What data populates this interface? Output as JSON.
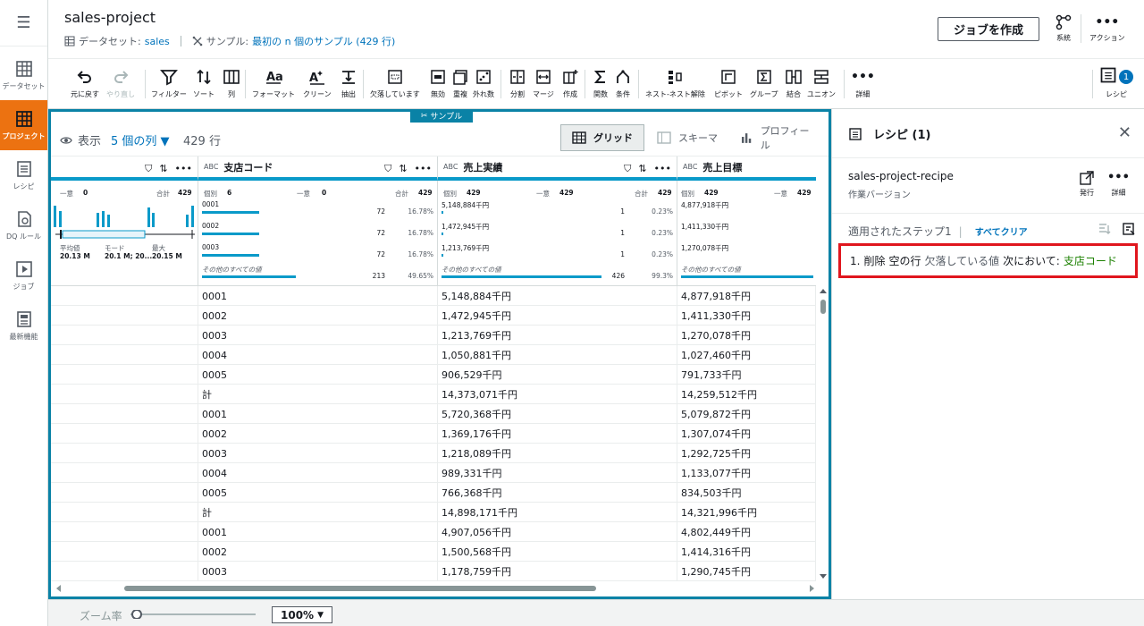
{
  "nav": {
    "items": [
      {
        "label": "データセット"
      },
      {
        "label": "プロジェクト"
      },
      {
        "label": "レシピ"
      },
      {
        "label": "DQ ルール"
      },
      {
        "label": "ジョブ"
      },
      {
        "label": "最新機能"
      }
    ]
  },
  "header": {
    "title": "sales-project",
    "dataset_prefix": "データセット:",
    "dataset_name": "sales",
    "sample_prefix": "サンプル:",
    "sample_value": "最初の n 個のサンプル (429 行)",
    "create_job": "ジョブを作成",
    "lineage": "系統",
    "actions": "アクション"
  },
  "toolbar": {
    "undo": "元に戻す",
    "redo": "やり直し",
    "filter": "フィルター",
    "sort": "ソート",
    "column": "列",
    "format": "フォーマット",
    "clean": "クリーン",
    "extract": "抽出",
    "missing": "欠落しています",
    "invalid": "無効",
    "duplicate": "重複",
    "outliers": "外れ数",
    "split": "分割",
    "merge": "マージ",
    "create": "作成",
    "functions": "関数",
    "condition": "条件",
    "nest": "ネスト-ネスト解除",
    "pivot": "ピボット",
    "group": "グループ",
    "join": "結合",
    "union": "ユニオン",
    "details": "詳細",
    "recipe": "レシピ",
    "recipe_count": "1"
  },
  "grid": {
    "sample_tag": "サンプル",
    "view_label": "表示",
    "columns_label": "5 個の列 ▼",
    "rows_label": "429 行",
    "views": {
      "grid": "グリッド",
      "schema": "スキーマ",
      "profile": "プロフィール"
    },
    "columns": [
      {
        "type": "",
        "name": ""
      },
      {
        "type": "ABC",
        "name": "支店コード"
      },
      {
        "type": "ABC",
        "name": "売上実績"
      },
      {
        "type": "ABC",
        "name": "売上目標"
      }
    ],
    "profile_c0": {
      "unique_label": "一意",
      "unique_val": "0",
      "total_label": "合計",
      "total_val": "429",
      "mean_label": "平均値",
      "mean_val": "20.13 M",
      "mode_label": "モード",
      "mode_val": "20.1 M; 20....",
      "max_label": "最大",
      "max_val": "20.15 M"
    },
    "profile_c1": {
      "distinct_label": "個別",
      "distinct_val": "6",
      "unique_label": "一意",
      "unique_val": "0",
      "total_label": "合計",
      "total_val": "429",
      "values": [
        {
          "name": "0001",
          "count": "72",
          "pct": "16.78%",
          "frac": 0.17
        },
        {
          "name": "0002",
          "count": "72",
          "pct": "16.78%",
          "frac": 0.17
        },
        {
          "name": "0003",
          "count": "72",
          "pct": "16.78%",
          "frac": 0.17
        },
        {
          "name": "その他のすべての値",
          "count": "213",
          "pct": "49.65%",
          "frac": 0.5
        }
      ]
    },
    "profile_c2": {
      "distinct_label": "個別",
      "distinct_val": "429",
      "unique_label": "一意",
      "unique_val": "429",
      "total_label": "合計",
      "total_val": "429",
      "values": [
        {
          "name": "5,148,884千円",
          "count": "1",
          "pct": "0.23%",
          "frac": 0.0023
        },
        {
          "name": "1,472,945千円",
          "count": "1",
          "pct": "0.23%",
          "frac": 0.0023
        },
        {
          "name": "1,213,769千円",
          "count": "1",
          "pct": "0.23%",
          "frac": 0.0023
        },
        {
          "name": "その他のすべての値",
          "count": "426",
          "pct": "99.3%",
          "frac": 0.993
        }
      ]
    },
    "profile_c3": {
      "distinct_label": "個別",
      "distinct_val": "429",
      "unique_label": "一意",
      "unique_val": "429",
      "values": [
        {
          "name": "4,877,918千円"
        },
        {
          "name": "1,411,330千円"
        },
        {
          "name": "1,270,078千円"
        },
        {
          "name": "その他のすべての値"
        }
      ]
    },
    "rows": [
      [
        "0001",
        "5,148,884千円",
        "4,877,918千円"
      ],
      [
        "0002",
        "1,472,945千円",
        "1,411,330千円"
      ],
      [
        "0003",
        "1,213,769千円",
        "1,270,078千円"
      ],
      [
        "0004",
        "1,050,881千円",
        "1,027,460千円"
      ],
      [
        "0005",
        "906,529千円",
        "791,733千円"
      ],
      [
        "計",
        "14,373,071千円",
        "14,259,512千円"
      ],
      [
        "0001",
        "5,720,368千円",
        "5,079,872千円"
      ],
      [
        "0002",
        "1,369,176千円",
        "1,307,074千円"
      ],
      [
        "0003",
        "1,218,089千円",
        "1,292,725千円"
      ],
      [
        "0004",
        "989,331千円",
        "1,133,077千円"
      ],
      [
        "0005",
        "766,368千円",
        "834,503千円"
      ],
      [
        "計",
        "14,898,171千円",
        "14,321,996千円"
      ],
      [
        "0001",
        "4,907,056千円",
        "4,802,449千円"
      ],
      [
        "0002",
        "1,500,568千円",
        "1,414,316千円"
      ],
      [
        "0003",
        "1,178,759千円",
        "1,290,745千円"
      ]
    ]
  },
  "recipe_panel": {
    "title": "レシピ (1)",
    "recipe_name": "sales-project-recipe",
    "version": "作業バージョン",
    "publish": "発行",
    "details": "詳細",
    "applied_steps": "適用されたステップ1",
    "clear_all": "すべてクリア",
    "step": {
      "num": "1.",
      "action": "削除",
      "target": "空の行",
      "cond": "欠落している値",
      "in": "次において:",
      "column": "支店コード"
    }
  },
  "footer": {
    "zoom_label": "ズーム率",
    "zoom_value": "100%",
    "zoom_fraction": 0.05
  },
  "colors": {
    "accent": "#ec7211",
    "grid_border": "#0a82a6",
    "bar": "#0a9ac9",
    "link": "#0073bb",
    "highlight": "#e0161e",
    "green": "#1d8102"
  }
}
